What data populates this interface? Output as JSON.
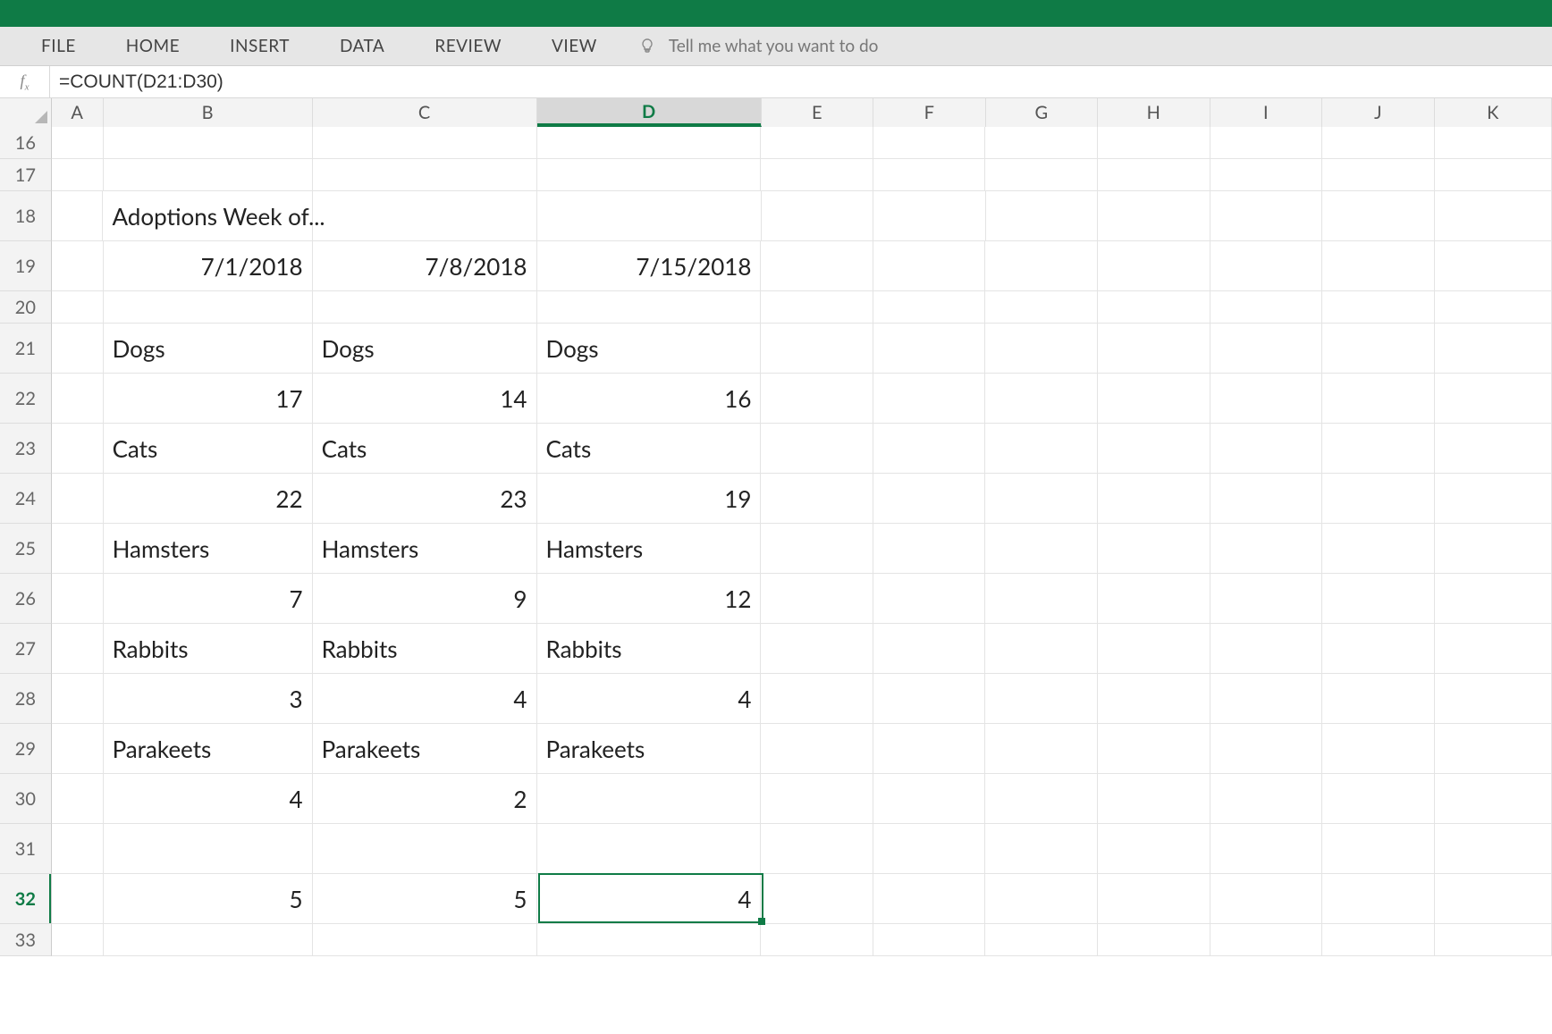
{
  "app": {
    "title": ""
  },
  "ribbon": {
    "tabs": [
      "FILE",
      "HOME",
      "INSERT",
      "DATA",
      "REVIEW",
      "VIEW"
    ],
    "tellme_placeholder": "Tell me what you want to do"
  },
  "formula_bar": {
    "fx_label": "fx",
    "formula": "=COUNT(D21:D30)"
  },
  "columns": [
    "A",
    "B",
    "C",
    "D",
    "E",
    "F",
    "G",
    "H",
    "I",
    "J",
    "K"
  ],
  "selected_column": "D",
  "selected_row": "32",
  "selected_cell_ref": "D32",
  "row_numbers": [
    "16",
    "17",
    "18",
    "19",
    "20",
    "21",
    "22",
    "23",
    "24",
    "25",
    "26",
    "27",
    "28",
    "29",
    "30",
    "31",
    "32",
    "33"
  ],
  "cells": {
    "B18": "Adoptions Week of...",
    "B19": "7/1/2018",
    "C19": "7/8/2018",
    "D19": "7/15/2018",
    "B21": "Dogs",
    "C21": "Dogs",
    "D21": "Dogs",
    "B22": "17",
    "C22": "14",
    "D22": "16",
    "B23": "Cats",
    "C23": "Cats",
    "D23": "Cats",
    "B24": "22",
    "C24": "23",
    "D24": "19",
    "B25": "Hamsters",
    "C25": "Hamsters",
    "D25": "Hamsters",
    "B26": "7",
    "C26": "9",
    "D26": "12",
    "B27": "Rabbits",
    "C27": "Rabbits",
    "D27": "Rabbits",
    "B28": "3",
    "C28": "4",
    "D28": "4",
    "B29": "Parakeets",
    "C29": "Parakeets",
    "D29": "Parakeets",
    "B30": "4",
    "C30": "2",
    "B32": "5",
    "C32": "5",
    "D32": "4"
  }
}
